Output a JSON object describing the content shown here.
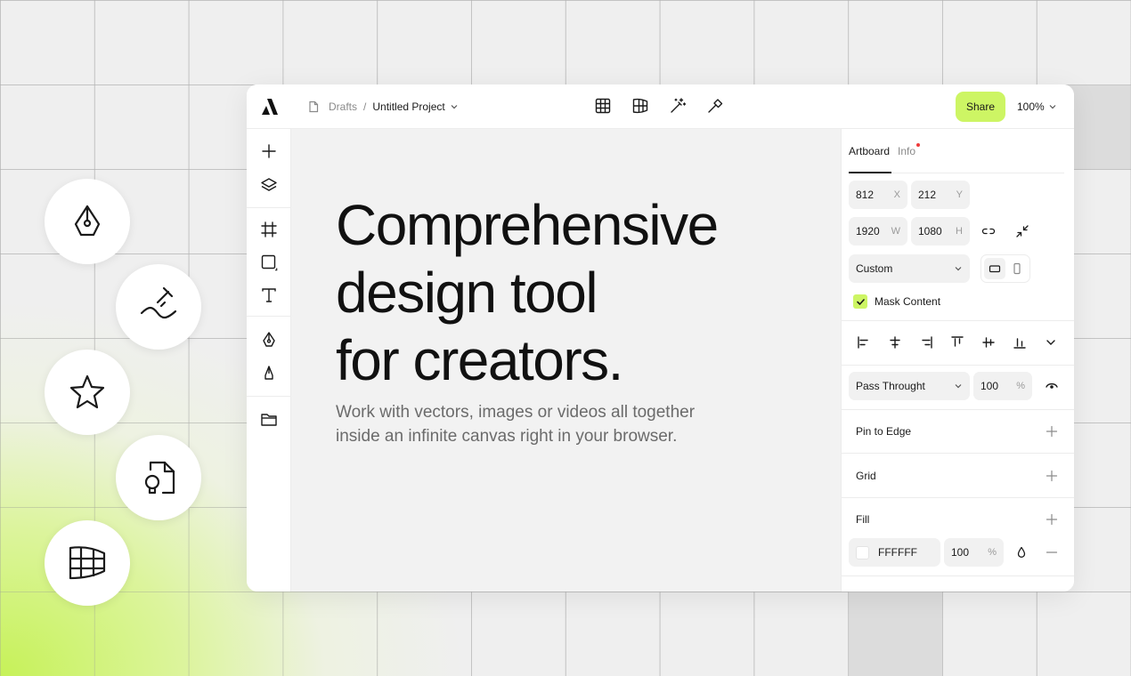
{
  "header": {
    "breadcrumb_root": "Drafts",
    "breadcrumb_separator": "/",
    "project_name": "Untitled Project",
    "share_label": "Share",
    "zoom_level": "100%"
  },
  "top_tools": [
    "table-icon",
    "layout-icon",
    "magic-wand-icon",
    "hammer-icon"
  ],
  "left_tools": [
    "plus-icon",
    "layers-icon",
    "frame-icon",
    "rectangle-icon",
    "text-icon",
    "pen-icon",
    "pencil-icon",
    "folder-icon"
  ],
  "floating_tools": [
    "pen-tool-icon",
    "text-on-path-icon",
    "star-icon",
    "file-idea-icon",
    "warp-grid-icon"
  ],
  "canvas": {
    "headline": "Comprehensive\ndesign tool\nfor creators.",
    "subtext": "Work with vectors, images or videos all together\ninside an infinite canvas right in your browser."
  },
  "panel": {
    "tabs": [
      "Artboard",
      "Info"
    ],
    "position": {
      "x": "812",
      "x_unit": "X",
      "y": "212",
      "y_unit": "Y"
    },
    "size": {
      "w": "1920",
      "w_unit": "W",
      "h": "1080",
      "h_unit": "H"
    },
    "preset": "Custom",
    "mask_content_label": "Mask Content",
    "mask_content_checked": true,
    "blend_mode": "Pass Throught",
    "opacity": "100",
    "opacity_unit": "%",
    "sections": [
      "Pin to Edge",
      "Grid",
      "Fill"
    ],
    "fill": {
      "hex": "FFFFFF",
      "opacity": "100",
      "opacity_unit": "%"
    }
  },
  "colors": {
    "accent": "#cdf564",
    "notification_dot": "#ef3b3b",
    "canvas_bg": "#f2f2f2"
  }
}
